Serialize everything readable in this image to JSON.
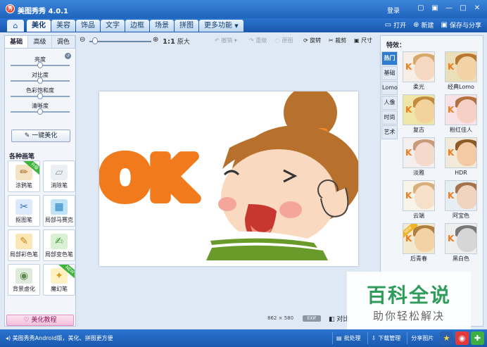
{
  "app": {
    "title": "美图秀秀 4.0.1",
    "logo_text": "秀",
    "login_label": "登录",
    "window_controls": [
      "▢",
      "▣",
      "—",
      "□",
      "✕"
    ]
  },
  "main_tabs": [
    {
      "label": "美化",
      "active": true
    },
    {
      "label": "美容",
      "active": false
    },
    {
      "label": "饰品",
      "active": false
    },
    {
      "label": "文字",
      "active": false
    },
    {
      "label": "边框",
      "active": false
    },
    {
      "label": "场景",
      "active": false
    },
    {
      "label": "拼图",
      "active": false
    },
    {
      "label": "更多功能",
      "active": false
    }
  ],
  "top_actions": {
    "open": "打开",
    "new": "新建",
    "save_share": "保存与分享"
  },
  "left_panel": {
    "tabs": [
      "基础",
      "高级",
      "调色"
    ],
    "sliders": [
      {
        "label": "亮度",
        "value": 0.5
      },
      {
        "label": "对比度",
        "value": 0.5
      },
      {
        "label": "色彩饱和度",
        "value": 0.5
      },
      {
        "label": "清晰度",
        "value": 0.5
      }
    ],
    "one_click_label": "一键美化",
    "section_title": "各种画笔",
    "tools": [
      {
        "label": "涂鸦笔",
        "icon": "brush-icon",
        "badge": "升级"
      },
      {
        "label": "消除笔",
        "icon": "eraser-icon",
        "badge": ""
      },
      {
        "label": "抠图笔",
        "icon": "cutout-icon",
        "badge": ""
      },
      {
        "label": "局部马赛克",
        "icon": "mosaic-icon",
        "badge": ""
      },
      {
        "label": "局部彩色笔",
        "icon": "color-pen-icon",
        "badge": ""
      },
      {
        "label": "局部变色笔",
        "icon": "recolor-pen-icon",
        "badge": ""
      },
      {
        "label": "背景虚化",
        "icon": "blur-icon",
        "badge": ""
      },
      {
        "label": "魔幻笔",
        "icon": "magic-pen-icon",
        "badge": "NEW"
      }
    ],
    "tutorial_label": "美化教程"
  },
  "canvas_toolbar": {
    "zoom_value": 0.05,
    "original_size": "1:1",
    "original_size_label": "原大",
    "undo": "撤销",
    "redo": "重做",
    "restore": "原图",
    "rotate": "旋转",
    "crop": "裁剪",
    "resize": "尺寸"
  },
  "canvas": {
    "ok_text": "OK",
    "dimensions_w": "862",
    "dimensions_x": "×",
    "dimensions_h": "580",
    "exif_label": "EXIF",
    "compare_label": "对比"
  },
  "right_panel": {
    "title": "特效：",
    "tabs": [
      {
        "label": "热门",
        "active": true
      },
      {
        "label": "基础",
        "active": false
      },
      {
        "label": "Lomo",
        "active": false
      },
      {
        "label": "人像",
        "active": false
      },
      {
        "label": "时尚",
        "active": false
      },
      {
        "label": "艺术",
        "active": false
      }
    ],
    "effects": [
      {
        "label": "柔光",
        "bg": "#f7efe6",
        "face": "#f6d7c0",
        "hair": "#d9a86a"
      },
      {
        "label": "经典Lomo",
        "bg": "#eadfb8",
        "face": "#f2d3a8",
        "hair": "#b9782f"
      },
      {
        "label": "复古",
        "bg": "#efe5a6",
        "face": "#f3d39c",
        "hair": "#c38b3d"
      },
      {
        "label": "粉红佳人",
        "bg": "#f8e2e6",
        "face": "#f6cfc5",
        "hair": "#b2713f"
      },
      {
        "label": "淡雅",
        "bg": "#f4eeee",
        "face": "#f4d9cd",
        "hair": "#c99a7a"
      },
      {
        "label": "HDR",
        "bg": "#f2ead8",
        "face": "#f4caa5",
        "hair": "#8d5a25"
      },
      {
        "label": "云端",
        "bg": "#f8f4e8",
        "face": "#f7e0c9",
        "hair": "#d8b07c"
      },
      {
        "label": "阿宝色",
        "bg": "#e6eef2",
        "face": "#f1d4c0",
        "hair": "#a4734c"
      },
      {
        "label": "后青春",
        "bg": "#f2ead0",
        "face": "#f3d2a6",
        "hair": "#b07f3c",
        "badge": "NEW"
      },
      {
        "label": "黑白色",
        "bg": "#eeeeee",
        "face": "#d6d6d6",
        "hair": "#777777"
      }
    ]
  },
  "watermark": {
    "title": "百科全说",
    "subtitle": "助你轻松解决"
  },
  "status_bar": {
    "text": "美图秀秀Android版，美化、拼图更方便",
    "batch": "批处理",
    "download": "下载管理",
    "share": "分享图片"
  },
  "colors": {
    "titlebar": "#1f63bd",
    "ok_orange": "#f07a1c",
    "hair_brown": "#b8712d",
    "shirt_green": "#6a9a2a",
    "skin": "#f9d9bf"
  }
}
